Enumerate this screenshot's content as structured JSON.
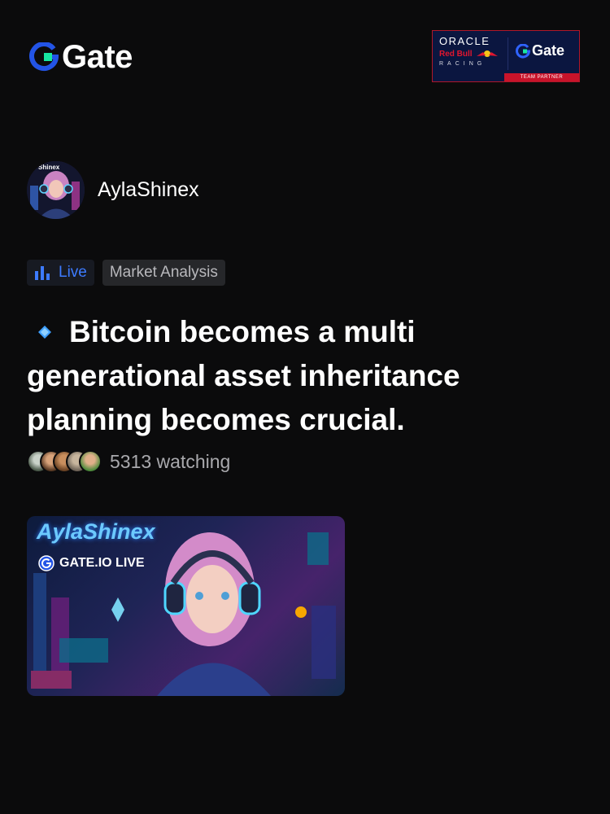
{
  "header": {
    "logo_text": "Gate",
    "partner": {
      "oracle": "ORACLE",
      "redbull": "Red Bull",
      "racing": "RACING",
      "gate": "Gate",
      "team_partner": "TEAM PARTNER"
    }
  },
  "author": {
    "name": "AylaShinex",
    "avatar_label": "Shinex"
  },
  "tags": {
    "live": "Live",
    "category": "Market Analysis"
  },
  "headline": "Bitcoin becomes a multi generational asset inheritance planning becomes crucial.",
  "viewers": {
    "text": "5313 watching"
  },
  "thumbnail": {
    "title": "AylaShinex",
    "badge": "GATE.IO LIVE"
  },
  "colors": {
    "background": "#0b0b0c",
    "accent_blue": "#3d7bff",
    "brand_green": "#17e6a1",
    "brand_blue": "#2354e6"
  }
}
